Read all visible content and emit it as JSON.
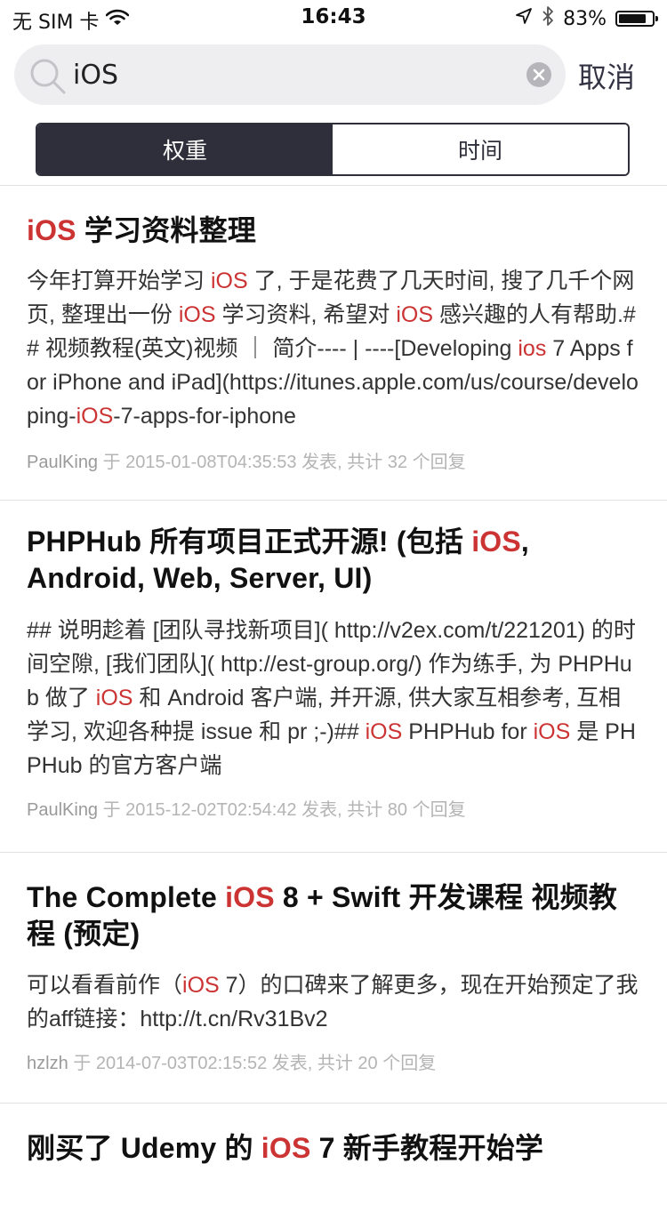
{
  "status_bar": {
    "carrier": "无 SIM 卡",
    "time": "16:43",
    "battery_percent": "83%",
    "battery_level": 0.83,
    "icons": [
      "wifi-icon",
      "location-arrow-icon",
      "bluetooth-icon",
      "battery-icon"
    ]
  },
  "search": {
    "value": "iOS",
    "placeholder": "",
    "cancel_label": "取消"
  },
  "sort_tabs": [
    {
      "label": "权重",
      "active": true
    },
    {
      "label": "时间",
      "active": false
    }
  ],
  "colors": {
    "highlight": "#cc3333",
    "segment_dark": "#2f2f3b",
    "meta_gray": "#b4b4b4"
  },
  "results": [
    {
      "title": [
        {
          "text": "iOS",
          "hl": true
        },
        {
          "text": " 学习资料整理",
          "hl": false
        }
      ],
      "body": [
        {
          "text": "今年打算开始学习 ",
          "hl": false
        },
        {
          "text": "iOS",
          "hl": true
        },
        {
          "text": " 了, 于是花费了几天时间, 搜了几千个网页, 整理出一份 ",
          "hl": false
        },
        {
          "text": "iOS",
          "hl": true
        },
        {
          "text": " 学习资料, 希望对 ",
          "hl": false
        },
        {
          "text": "iOS",
          "hl": true
        },
        {
          "text": " 感兴趣的人有帮助.## 视频教程(英文)视频 ｜ 简介---- | ----[Developing ",
          "hl": false
        },
        {
          "text": "ios",
          "hl": true
        },
        {
          "text": " 7 Apps for iPhone and iPad](https://itunes.apple.com/us/course/developing-",
          "hl": false
        },
        {
          "text": "iOS",
          "hl": true
        },
        {
          "text": "-7-apps-for-iphone",
          "hl": false
        }
      ],
      "author": "PaulKing",
      "meta": " 于 2015-01-08T04:35:53 发表, 共计 32 个回复"
    },
    {
      "title": [
        {
          "text": "PHPHub 所有项目正式开源! (包括 ",
          "hl": false
        },
        {
          "text": "iOS",
          "hl": true
        },
        {
          "text": ", Android, Web, Server, UI)",
          "hl": false
        }
      ],
      "body": [
        {
          "text": "## 说明趁着 [团队寻找新项目]( http://v2ex.com/t/221201) 的时间空隙, [我们团队]( http://est-group.org/) 作为练手, 为 PHPHub 做了 ",
          "hl": false
        },
        {
          "text": "iOS",
          "hl": true
        },
        {
          "text": " 和 Android 客户端, 并开源, 供大家互相参考, 互相学习, 欢迎各种提 issue 和 pr ;-)## ",
          "hl": false
        },
        {
          "text": "iOS",
          "hl": true
        },
        {
          "text": " PHPHub for ",
          "hl": false
        },
        {
          "text": "iOS",
          "hl": true
        },
        {
          "text": " 是 PHPHub 的官方客户端",
          "hl": false
        }
      ],
      "author": "PaulKing",
      "meta": " 于 2015-12-02T02:54:42 发表, 共计 80 个回复"
    },
    {
      "title": [
        {
          "text": "The Complete ",
          "hl": false
        },
        {
          "text": "iOS",
          "hl": true
        },
        {
          "text": " 8 + Swift 开发课程 视频教程 (预定)",
          "hl": false
        }
      ],
      "body": [
        {
          "text": " 可以看看前作（",
          "hl": false
        },
        {
          "text": "iOS",
          "hl": true
        },
        {
          "text": " 7）的口碑来了解更多，现在开始预定了我的aff链接：http://t.cn/Rv31Bv2",
          "hl": false
        }
      ],
      "author": "hzlzh",
      "meta": " 于 2014-07-03T02:15:52 发表, 共计 20 个回复"
    },
    {
      "title": [
        {
          "text": "刚买了 Udemy 的 ",
          "hl": false
        },
        {
          "text": "iOS",
          "hl": true
        },
        {
          "text": " 7 新手教程开始学",
          "hl": false
        }
      ],
      "body": [],
      "author": "",
      "meta": ""
    }
  ]
}
